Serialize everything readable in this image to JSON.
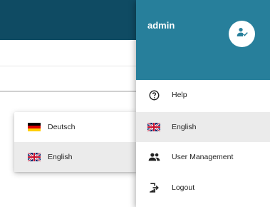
{
  "user": {
    "name": "admin",
    "avatar_icon": "user-check-icon"
  },
  "user_menu": {
    "items": [
      {
        "label": "Help",
        "icon": "help-circle-icon",
        "selected": false
      },
      {
        "label": "English",
        "icon": "uk-flag-icon",
        "selected": true
      },
      {
        "label": "User Management",
        "icon": "users-icon",
        "selected": false
      },
      {
        "label": "Logout",
        "icon": "logout-icon",
        "selected": false
      }
    ]
  },
  "language_menu": {
    "items": [
      {
        "label": "Deutsch",
        "icon": "german-flag-icon",
        "selected": false
      },
      {
        "label": "English",
        "icon": "uk-flag-icon",
        "selected": true
      }
    ]
  },
  "colors": {
    "topbar": "#0f4b63",
    "user_header": "#277f9b",
    "selected_bg": "#ebebeb"
  }
}
